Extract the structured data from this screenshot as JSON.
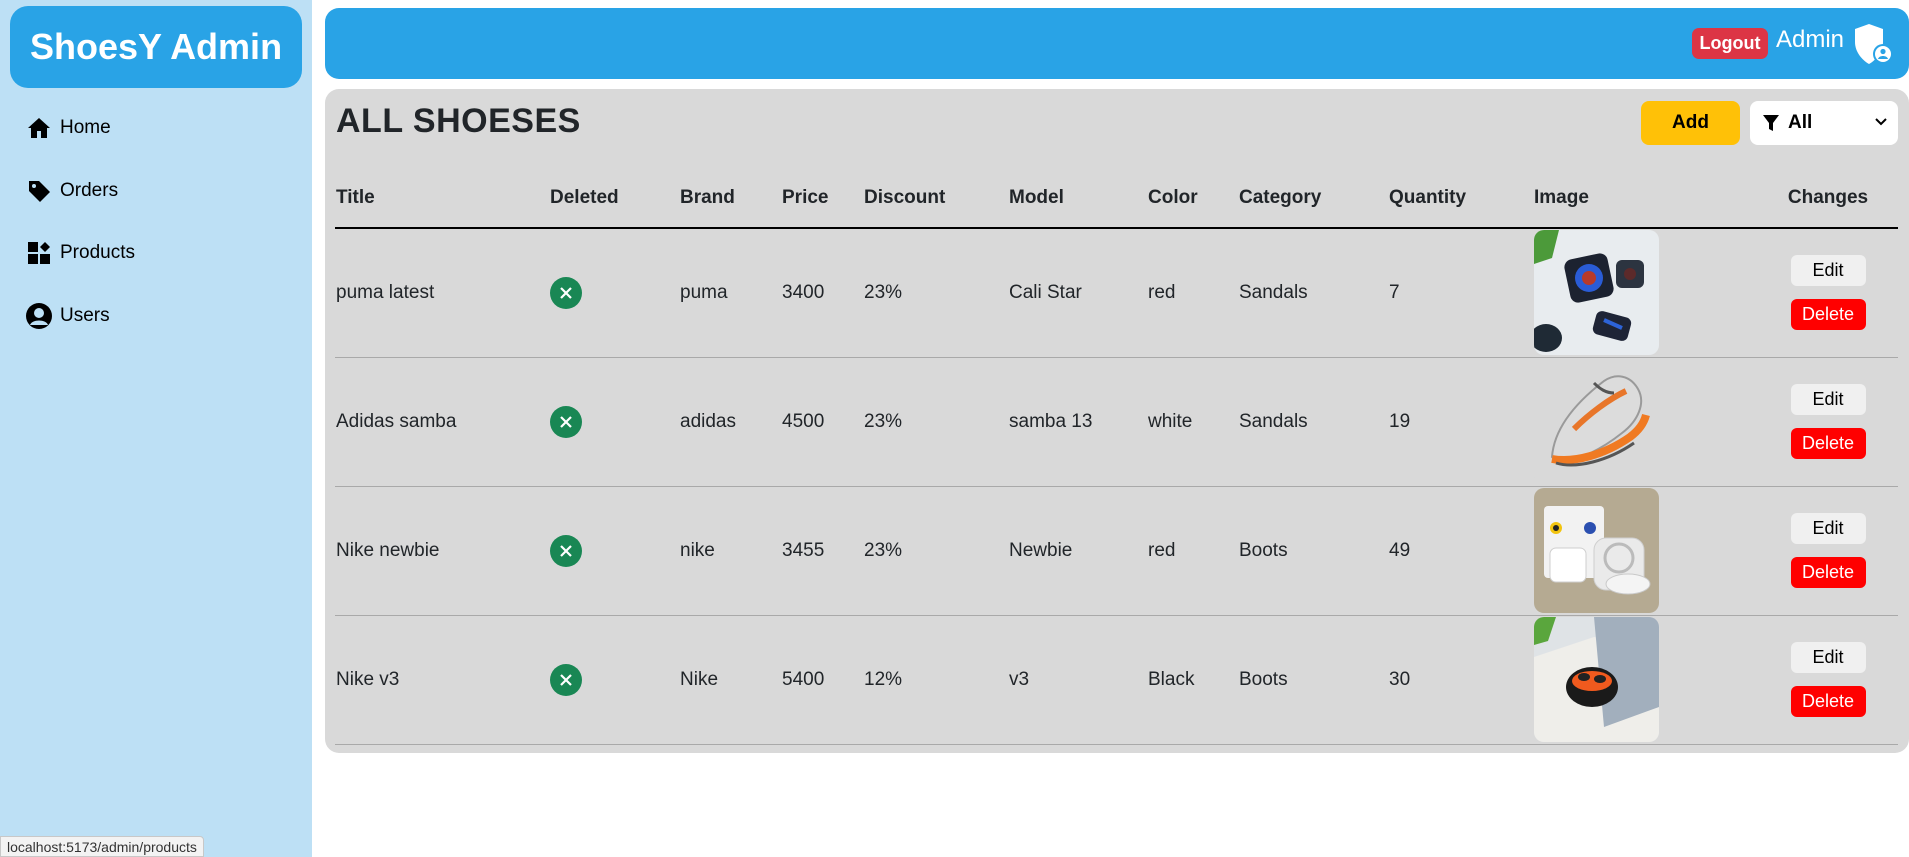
{
  "brand": {
    "title": "ShoesY Admin"
  },
  "sidebar": {
    "items": [
      {
        "label": "Home",
        "icon": "home-icon"
      },
      {
        "label": "Orders",
        "icon": "tag-icon"
      },
      {
        "label": "Products",
        "icon": "dashboard-icon"
      },
      {
        "label": "Users",
        "icon": "user-circle-icon"
      }
    ]
  },
  "header": {
    "logout_label": "Logout",
    "user_label": "Admin",
    "user_icon": "admin-shield-icon"
  },
  "main": {
    "title": "ALL SHOESES",
    "add_label": "Add",
    "filter": {
      "icon": "filter-icon",
      "selected": "All"
    }
  },
  "table": {
    "columns": [
      "Title",
      "Deleted",
      "Brand",
      "Price",
      "Discount",
      "Model",
      "Color",
      "Category",
      "Quantity",
      "Image",
      "Changes"
    ],
    "rows": [
      {
        "title": "puma latest",
        "deleted": "x-circle-icon",
        "brand": "puma",
        "price": "3400",
        "discount": "23%",
        "model": "Cali Star",
        "color": "red",
        "category": "Sandals",
        "quantity": "7",
        "edit": "Edit",
        "delete": "Delete"
      },
      {
        "title": "Adidas samba",
        "deleted": "x-circle-icon",
        "brand": "adidas",
        "price": "4500",
        "discount": "23%",
        "model": "samba 13",
        "color": "white",
        "category": "Sandals",
        "quantity": "19",
        "edit": "Edit",
        "delete": "Delete"
      },
      {
        "title": "Nike newbie",
        "deleted": "x-circle-icon",
        "brand": "nike",
        "price": "3455",
        "discount": "23%",
        "model": "Newbie",
        "color": "red",
        "category": "Boots",
        "quantity": "49",
        "edit": "Edit",
        "delete": "Delete"
      },
      {
        "title": "Nike v3",
        "deleted": "x-circle-icon",
        "brand": "Nike",
        "price": "5400",
        "discount": "12%",
        "model": "v3",
        "color": "Black",
        "category": "Boots",
        "quantity": "30",
        "edit": "Edit",
        "delete": "Delete"
      }
    ]
  },
  "status_bar": {
    "url": "localhost:5173/admin/products"
  },
  "colors": {
    "primary": "#29a3e6",
    "sidebar": "#bde0f5",
    "panel": "#d9d9d9",
    "danger": "#dc3545",
    "delete": "#ff0000",
    "warning": "#ffc107",
    "success": "#198754"
  }
}
